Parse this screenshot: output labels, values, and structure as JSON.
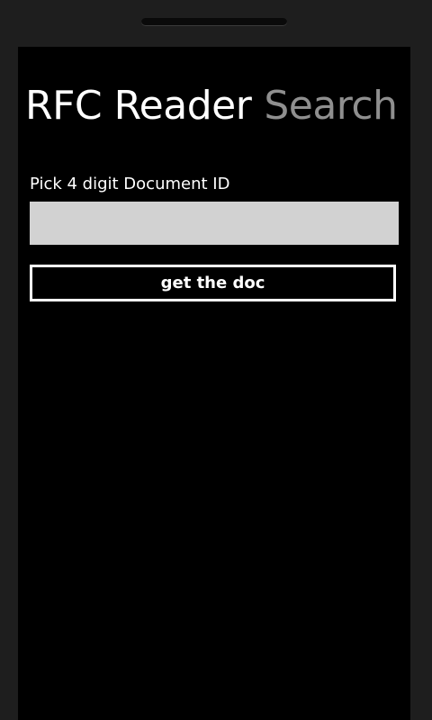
{
  "header": {
    "app_title": "RFC Reader",
    "page_title": "Search"
  },
  "form": {
    "label": "Pick 4 digit Document ID",
    "input_value": "",
    "submit_label": "get the doc"
  },
  "colors": {
    "background": "#000000",
    "foreground": "#ffffff",
    "subtle_title": "#8f8f8f",
    "input_background": "#d2d2d2"
  }
}
